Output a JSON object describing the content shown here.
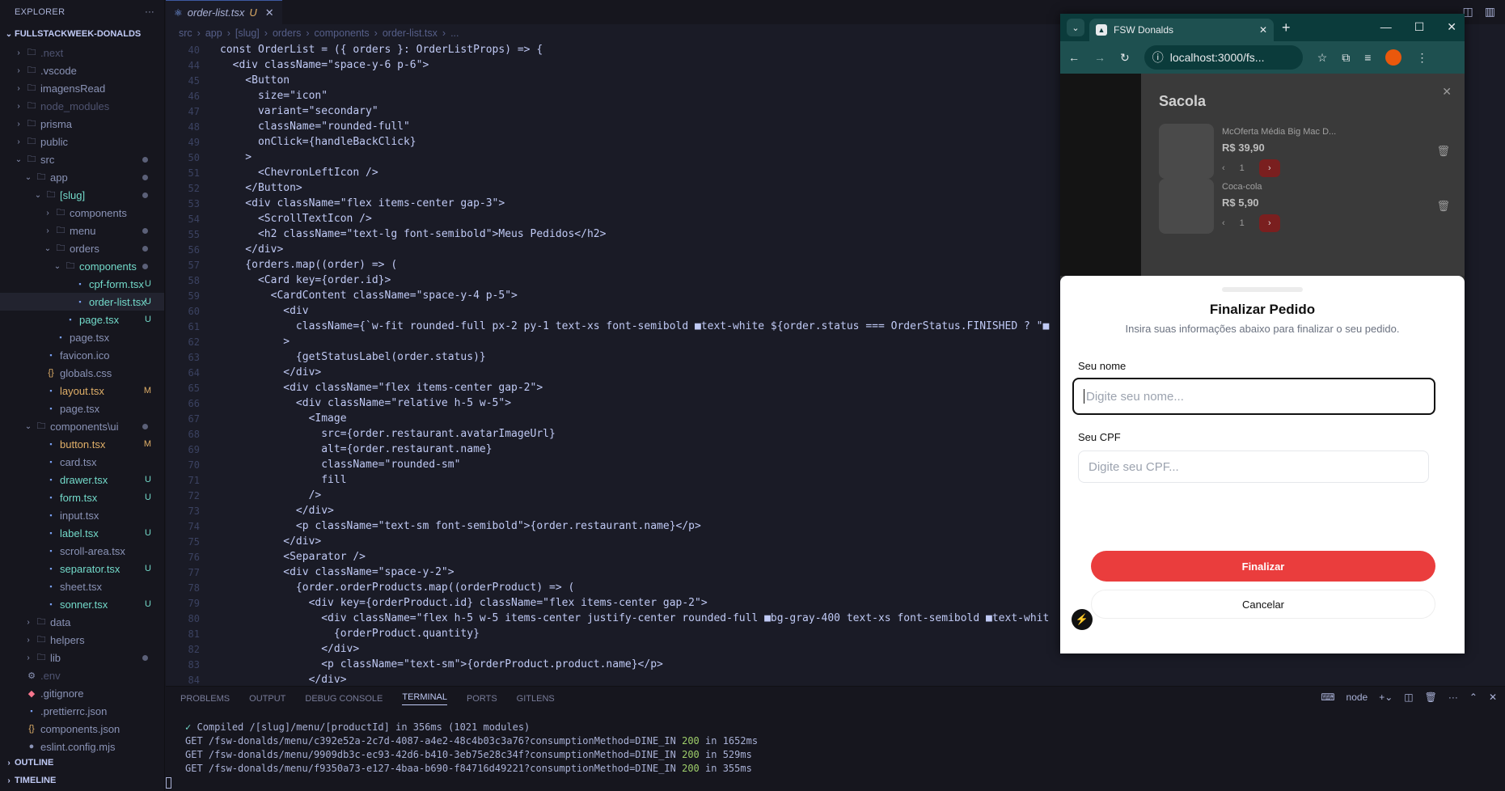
{
  "explorer": {
    "title": "EXPLORER",
    "more": "···",
    "project": "FULLSTACKWEEK-DONALDS",
    "items": [
      {
        "label": ".next",
        "chev": "›",
        "icon": "folder",
        "color": "dim"
      },
      {
        "label": ".vscode",
        "chev": "›",
        "icon": "folder",
        "color": "normal"
      },
      {
        "label": "imagensRead",
        "chev": "›",
        "icon": "folder",
        "color": "normal"
      },
      {
        "label": "node_modules",
        "chev": "›",
        "icon": "folder",
        "color": "dim"
      },
      {
        "label": "prisma",
        "chev": "›",
        "icon": "folder",
        "color": "normal"
      },
      {
        "label": "public",
        "chev": "›",
        "icon": "folder",
        "color": "normal"
      },
      {
        "label": "src",
        "chev": "⌄",
        "icon": "folder",
        "color": "normal",
        "dot": true
      },
      {
        "label": "app",
        "chev": "⌄",
        "icon": "folder",
        "color": "normal",
        "dot": true
      },
      {
        "label": "[slug]",
        "chev": "⌄",
        "icon": "folder",
        "color": "green",
        "dot": true
      },
      {
        "label": "components",
        "chev": "›",
        "icon": "folder",
        "color": "normal"
      },
      {
        "label": "menu",
        "chev": "›",
        "icon": "folder",
        "color": "normal",
        "dot": true
      },
      {
        "label": "orders",
        "chev": "⌄",
        "icon": "folder",
        "color": "normal",
        "dot": true
      },
      {
        "label": "components",
        "chev": "⌄",
        "icon": "folder",
        "color": "green",
        "dot": true
      },
      {
        "label": "cpf-form.tsx",
        "chev": "",
        "icon": "file",
        "color": "green",
        "badge": "U"
      },
      {
        "label": "order-list.tsx",
        "chev": "",
        "icon": "file",
        "color": "green",
        "badge": "U",
        "selected": true
      },
      {
        "label": "page.tsx",
        "chev": "",
        "icon": "file",
        "color": "green",
        "badge": "U"
      },
      {
        "label": "page.tsx",
        "chev": "",
        "icon": "file",
        "color": "normal"
      },
      {
        "label": "favicon.ico",
        "chev": "",
        "icon": "file",
        "color": "normal"
      },
      {
        "label": "globals.css",
        "chev": "",
        "icon": "braces",
        "color": "normal"
      },
      {
        "label": "layout.tsx",
        "chev": "",
        "icon": "file",
        "color": "yellow",
        "badge": "M"
      },
      {
        "label": "page.tsx",
        "chev": "",
        "icon": "file",
        "color": "normal"
      },
      {
        "label": "components\\ui",
        "chev": "⌄",
        "icon": "folder",
        "color": "normal",
        "dot": true
      },
      {
        "label": "button.tsx",
        "chev": "",
        "icon": "file",
        "color": "yellow",
        "badge": "M"
      },
      {
        "label": "card.tsx",
        "chev": "",
        "icon": "file",
        "color": "normal"
      },
      {
        "label": "drawer.tsx",
        "chev": "",
        "icon": "file",
        "color": "green",
        "badge": "U"
      },
      {
        "label": "form.tsx",
        "chev": "",
        "icon": "file",
        "color": "green",
        "badge": "U"
      },
      {
        "label": "input.tsx",
        "chev": "",
        "icon": "file",
        "color": "normal"
      },
      {
        "label": "label.tsx",
        "chev": "",
        "icon": "file",
        "color": "green",
        "badge": "U"
      },
      {
        "label": "scroll-area.tsx",
        "chev": "",
        "icon": "file",
        "color": "normal"
      },
      {
        "label": "separator.tsx",
        "chev": "",
        "icon": "file",
        "color": "green",
        "badge": "U"
      },
      {
        "label": "sheet.tsx",
        "chev": "",
        "icon": "file",
        "color": "normal"
      },
      {
        "label": "sonner.tsx",
        "chev": "",
        "icon": "file",
        "color": "green",
        "badge": "U"
      },
      {
        "label": "data",
        "chev": "›",
        "icon": "folder",
        "color": "normal"
      },
      {
        "label": "helpers",
        "chev": "›",
        "icon": "folder",
        "color": "normal"
      },
      {
        "label": "lib",
        "chev": "›",
        "icon": "folder",
        "color": "normal",
        "dot": true
      },
      {
        "label": ".env",
        "chev": "",
        "icon": "gear",
        "color": "dim"
      },
      {
        "label": ".gitignore",
        "chev": "",
        "icon": "diamond",
        "color": "normal"
      },
      {
        "label": ".prettierrc.json",
        "chev": "",
        "icon": "file",
        "color": "normal"
      },
      {
        "label": "components.json",
        "chev": "",
        "icon": "braces",
        "color": "normal"
      },
      {
        "label": "eslint.config.mjs",
        "chev": "",
        "icon": "circle",
        "color": "normal"
      }
    ],
    "outline": "OUTLINE",
    "timeline": "TIMELINE"
  },
  "editor": {
    "tab": {
      "label": "order-list.tsx",
      "status": "U",
      "close": "✕"
    },
    "breadcrumb": [
      "src",
      "›",
      "app",
      "›",
      "[slug]",
      "›",
      "orders",
      "›",
      "components",
      "›",
      "order-list.tsx",
      "›",
      "..."
    ],
    "lines": [
      {
        "n": "40",
        "t": "const OrderList = ({ orders }: OrderListProps) => {"
      },
      {
        "n": "44",
        "t": "  <div className=\"space-y-6 p-6\">"
      },
      {
        "n": "45",
        "t": "    <Button"
      },
      {
        "n": "46",
        "t": "      size=\"icon\""
      },
      {
        "n": "47",
        "t": "      variant=\"secondary\""
      },
      {
        "n": "48",
        "t": "      className=\"rounded-full\""
      },
      {
        "n": "49",
        "t": "      onClick={handleBackClick}"
      },
      {
        "n": "50",
        "t": "    >"
      },
      {
        "n": "51",
        "t": "      <ChevronLeftIcon />"
      },
      {
        "n": "52",
        "t": "    </Button>"
      },
      {
        "n": "53",
        "t": "    <div className=\"flex items-center gap-3\">"
      },
      {
        "n": "54",
        "t": "      <ScrollTextIcon />"
      },
      {
        "n": "55",
        "t": "      <h2 className=\"text-lg font-semibold\">Meus Pedidos</h2>"
      },
      {
        "n": "56",
        "t": "    </div>"
      },
      {
        "n": "57",
        "t": "    {orders.map((order) => ("
      },
      {
        "n": "58",
        "t": "      <Card key={order.id}>"
      },
      {
        "n": "59",
        "t": "        <CardContent className=\"space-y-4 p-5\">"
      },
      {
        "n": "60",
        "t": "          <div"
      },
      {
        "n": "61",
        "t": "            className={`w-fit rounded-full px-2 py-1 text-xs font-semibold ■text-white ${order.status === OrderStatus.FINISHED ? \"■"
      },
      {
        "n": "62",
        "t": "          >"
      },
      {
        "n": "63",
        "t": "            {getStatusLabel(order.status)}"
      },
      {
        "n": "64",
        "t": "          </div>"
      },
      {
        "n": "65",
        "t": "          <div className=\"flex items-center gap-2\">"
      },
      {
        "n": "66",
        "t": "            <div className=\"relative h-5 w-5\">"
      },
      {
        "n": "67",
        "t": "              <Image"
      },
      {
        "n": "68",
        "t": "                src={order.restaurant.avatarImageUrl}"
      },
      {
        "n": "69",
        "t": "                alt={order.restaurant.name}"
      },
      {
        "n": "70",
        "t": "                className=\"rounded-sm\""
      },
      {
        "n": "71",
        "t": "                fill"
      },
      {
        "n": "72",
        "t": "              />"
      },
      {
        "n": "73",
        "t": "            </div>"
      },
      {
        "n": "74",
        "t": "            <p className=\"text-sm font-semibold\">{order.restaurant.name}</p>"
      },
      {
        "n": "75",
        "t": "          </div>"
      },
      {
        "n": "76",
        "t": "          <Separator />"
      },
      {
        "n": "77",
        "t": "          <div className=\"space-y-2\">"
      },
      {
        "n": "78",
        "t": "            {order.orderProducts.map((orderProduct) => ("
      },
      {
        "n": "79",
        "t": "              <div key={orderProduct.id} className=\"flex items-center gap-2\">"
      },
      {
        "n": "80",
        "t": "                <div className=\"flex h-5 w-5 items-center justify-center rounded-full ■bg-gray-400 text-xs font-semibold ■text-whit"
      },
      {
        "n": "81",
        "t": "                  {orderProduct.quantity}"
      },
      {
        "n": "82",
        "t": "                </div>"
      },
      {
        "n": "83",
        "t": "                <p className=\"text-sm\">{orderProduct.product.name}</p>"
      },
      {
        "n": "84",
        "t": "              </div>"
      }
    ]
  },
  "panel": {
    "tabs": [
      "PROBLEMS",
      "OUTPUT",
      "DEBUG CONSOLE",
      "TERMINAL",
      "PORTS",
      "GITLENS"
    ],
    "active_tab": "TERMINAL",
    "shell": "node",
    "terminal": {
      "compiled": "Compiled /[slug]/menu/[productId] in 356ms (1021 modules)",
      "lines": [
        {
          "path": "GET /fsw-donalds/menu/c392e52a-2c7d-4087-a4e2-48c4b03c3a76?consumptionMethod=DINE_IN",
          "code": "200",
          "time": "in 1652ms"
        },
        {
          "path": "GET /fsw-donalds/menu/9909db3c-ec93-42d6-b410-3eb75e28c34f?consumptionMethod=DINE_IN",
          "code": "200",
          "time": "in 529ms"
        },
        {
          "path": "GET /fsw-donalds/menu/f9350a73-e127-4baa-b690-f84716d49221?consumptionMethod=DINE_IN",
          "code": "200",
          "time": "in 355ms"
        }
      ]
    }
  },
  "browser": {
    "tab_title": "FSW Donalds",
    "url": "localhost:3000/fs...",
    "bag": {
      "title": "Sacola",
      "products": [
        {
          "name": "McOferta Média Big Mac D...",
          "price": "R$ 39,90",
          "qty": "1"
        },
        {
          "name": "Coca-cola",
          "price": "R$ 5,90",
          "qty": "1"
        }
      ]
    },
    "drawer": {
      "title": "Finalizar Pedido",
      "subtitle": "Insira suas informações abaixo para finalizar o seu pedido.",
      "name_label": "Seu nome",
      "name_placeholder": "Digite seu nome...",
      "cpf_label": "Seu CPF",
      "cpf_placeholder": "Digite seu CPF...",
      "submit": "Finalizar",
      "cancel": "Cancelar"
    }
  },
  "colors": {
    "accent_red": "#ea3d3d",
    "untracked": "#73daca",
    "modified": "#e0af68"
  }
}
